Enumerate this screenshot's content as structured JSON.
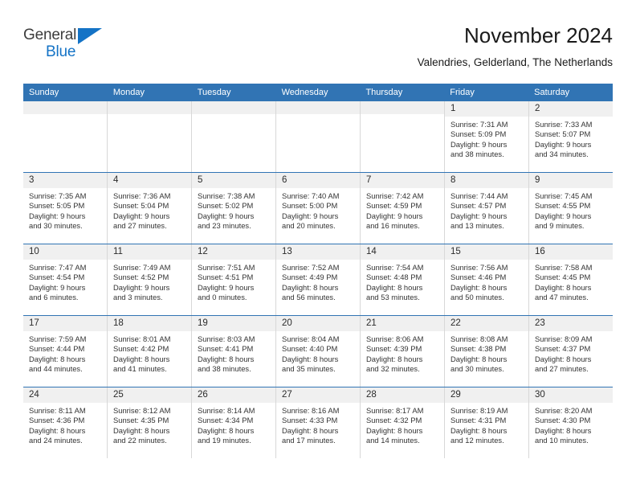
{
  "brand": {
    "name_primary": "General",
    "name_secondary": "Blue",
    "triangle_color": "#1473c6"
  },
  "header": {
    "title": "November 2024",
    "subtitle": "Valendries, Gelderland, The Netherlands",
    "accent_color": "#3174b4"
  },
  "weekdays": [
    "Sunday",
    "Monday",
    "Tuesday",
    "Wednesday",
    "Thursday",
    "Friday",
    "Saturday"
  ],
  "labels": {
    "sunrise_prefix": "Sunrise:",
    "sunset_prefix": "Sunset:",
    "daylight_prefix": "Daylight:"
  },
  "weeks": [
    [
      {
        "day": "",
        "empty": true
      },
      {
        "day": "",
        "empty": true
      },
      {
        "day": "",
        "empty": true
      },
      {
        "day": "",
        "empty": true
      },
      {
        "day": "",
        "empty": true
      },
      {
        "day": "1",
        "sunrise": "Sunrise: 7:31 AM",
        "sunset": "Sunset: 5:09 PM",
        "daylight1": "Daylight: 9 hours",
        "daylight2": "and 38 minutes."
      },
      {
        "day": "2",
        "sunrise": "Sunrise: 7:33 AM",
        "sunset": "Sunset: 5:07 PM",
        "daylight1": "Daylight: 9 hours",
        "daylight2": "and 34 minutes."
      }
    ],
    [
      {
        "day": "3",
        "sunrise": "Sunrise: 7:35 AM",
        "sunset": "Sunset: 5:05 PM",
        "daylight1": "Daylight: 9 hours",
        "daylight2": "and 30 minutes."
      },
      {
        "day": "4",
        "sunrise": "Sunrise: 7:36 AM",
        "sunset": "Sunset: 5:04 PM",
        "daylight1": "Daylight: 9 hours",
        "daylight2": "and 27 minutes."
      },
      {
        "day": "5",
        "sunrise": "Sunrise: 7:38 AM",
        "sunset": "Sunset: 5:02 PM",
        "daylight1": "Daylight: 9 hours",
        "daylight2": "and 23 minutes."
      },
      {
        "day": "6",
        "sunrise": "Sunrise: 7:40 AM",
        "sunset": "Sunset: 5:00 PM",
        "daylight1": "Daylight: 9 hours",
        "daylight2": "and 20 minutes."
      },
      {
        "day": "7",
        "sunrise": "Sunrise: 7:42 AM",
        "sunset": "Sunset: 4:59 PM",
        "daylight1": "Daylight: 9 hours",
        "daylight2": "and 16 minutes."
      },
      {
        "day": "8",
        "sunrise": "Sunrise: 7:44 AM",
        "sunset": "Sunset: 4:57 PM",
        "daylight1": "Daylight: 9 hours",
        "daylight2": "and 13 minutes."
      },
      {
        "day": "9",
        "sunrise": "Sunrise: 7:45 AM",
        "sunset": "Sunset: 4:55 PM",
        "daylight1": "Daylight: 9 hours",
        "daylight2": "and 9 minutes."
      }
    ],
    [
      {
        "day": "10",
        "sunrise": "Sunrise: 7:47 AM",
        "sunset": "Sunset: 4:54 PM",
        "daylight1": "Daylight: 9 hours",
        "daylight2": "and 6 minutes."
      },
      {
        "day": "11",
        "sunrise": "Sunrise: 7:49 AM",
        "sunset": "Sunset: 4:52 PM",
        "daylight1": "Daylight: 9 hours",
        "daylight2": "and 3 minutes."
      },
      {
        "day": "12",
        "sunrise": "Sunrise: 7:51 AM",
        "sunset": "Sunset: 4:51 PM",
        "daylight1": "Daylight: 9 hours",
        "daylight2": "and 0 minutes."
      },
      {
        "day": "13",
        "sunrise": "Sunrise: 7:52 AM",
        "sunset": "Sunset: 4:49 PM",
        "daylight1": "Daylight: 8 hours",
        "daylight2": "and 56 minutes."
      },
      {
        "day": "14",
        "sunrise": "Sunrise: 7:54 AM",
        "sunset": "Sunset: 4:48 PM",
        "daylight1": "Daylight: 8 hours",
        "daylight2": "and 53 minutes."
      },
      {
        "day": "15",
        "sunrise": "Sunrise: 7:56 AM",
        "sunset": "Sunset: 4:46 PM",
        "daylight1": "Daylight: 8 hours",
        "daylight2": "and 50 minutes."
      },
      {
        "day": "16",
        "sunrise": "Sunrise: 7:58 AM",
        "sunset": "Sunset: 4:45 PM",
        "daylight1": "Daylight: 8 hours",
        "daylight2": "and 47 minutes."
      }
    ],
    [
      {
        "day": "17",
        "sunrise": "Sunrise: 7:59 AM",
        "sunset": "Sunset: 4:44 PM",
        "daylight1": "Daylight: 8 hours",
        "daylight2": "and 44 minutes."
      },
      {
        "day": "18",
        "sunrise": "Sunrise: 8:01 AM",
        "sunset": "Sunset: 4:42 PM",
        "daylight1": "Daylight: 8 hours",
        "daylight2": "and 41 minutes."
      },
      {
        "day": "19",
        "sunrise": "Sunrise: 8:03 AM",
        "sunset": "Sunset: 4:41 PM",
        "daylight1": "Daylight: 8 hours",
        "daylight2": "and 38 minutes."
      },
      {
        "day": "20",
        "sunrise": "Sunrise: 8:04 AM",
        "sunset": "Sunset: 4:40 PM",
        "daylight1": "Daylight: 8 hours",
        "daylight2": "and 35 minutes."
      },
      {
        "day": "21",
        "sunrise": "Sunrise: 8:06 AM",
        "sunset": "Sunset: 4:39 PM",
        "daylight1": "Daylight: 8 hours",
        "daylight2": "and 32 minutes."
      },
      {
        "day": "22",
        "sunrise": "Sunrise: 8:08 AM",
        "sunset": "Sunset: 4:38 PM",
        "daylight1": "Daylight: 8 hours",
        "daylight2": "and 30 minutes."
      },
      {
        "day": "23",
        "sunrise": "Sunrise: 8:09 AM",
        "sunset": "Sunset: 4:37 PM",
        "daylight1": "Daylight: 8 hours",
        "daylight2": "and 27 minutes."
      }
    ],
    [
      {
        "day": "24",
        "sunrise": "Sunrise: 8:11 AM",
        "sunset": "Sunset: 4:36 PM",
        "daylight1": "Daylight: 8 hours",
        "daylight2": "and 24 minutes."
      },
      {
        "day": "25",
        "sunrise": "Sunrise: 8:12 AM",
        "sunset": "Sunset: 4:35 PM",
        "daylight1": "Daylight: 8 hours",
        "daylight2": "and 22 minutes."
      },
      {
        "day": "26",
        "sunrise": "Sunrise: 8:14 AM",
        "sunset": "Sunset: 4:34 PM",
        "daylight1": "Daylight: 8 hours",
        "daylight2": "and 19 minutes."
      },
      {
        "day": "27",
        "sunrise": "Sunrise: 8:16 AM",
        "sunset": "Sunset: 4:33 PM",
        "daylight1": "Daylight: 8 hours",
        "daylight2": "and 17 minutes."
      },
      {
        "day": "28",
        "sunrise": "Sunrise: 8:17 AM",
        "sunset": "Sunset: 4:32 PM",
        "daylight1": "Daylight: 8 hours",
        "daylight2": "and 14 minutes."
      },
      {
        "day": "29",
        "sunrise": "Sunrise: 8:19 AM",
        "sunset": "Sunset: 4:31 PM",
        "daylight1": "Daylight: 8 hours",
        "daylight2": "and 12 minutes."
      },
      {
        "day": "30",
        "sunrise": "Sunrise: 8:20 AM",
        "sunset": "Sunset: 4:30 PM",
        "daylight1": "Daylight: 8 hours",
        "daylight2": "and 10 minutes."
      }
    ]
  ]
}
